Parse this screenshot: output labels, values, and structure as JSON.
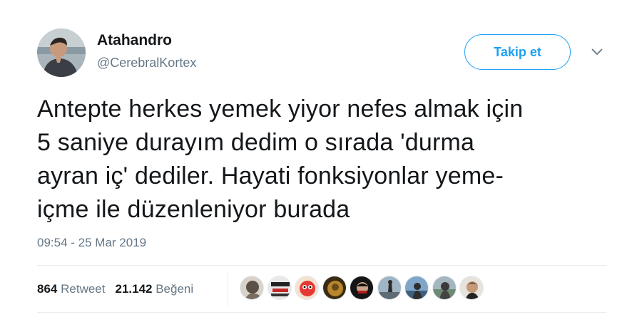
{
  "user": {
    "display_name": "Atahandro",
    "handle": "@CerebralKortex"
  },
  "follow_button": {
    "label": "Takip et"
  },
  "tweet": {
    "lines": [
      "Antepte herkes yemek yiyor nefes almak için",
      "5 saniye durayım dedim o sırada 'durma",
      "ayran iç' dediler. Hayati fonksiyonlar yeme-",
      "içme ile düzenleniyor burada"
    ],
    "timestamp": "09:54 - 25 Mar 2019"
  },
  "stats": {
    "retweet_count": "864",
    "retweet_label": "Retweet",
    "like_count": "21.142",
    "like_label": "Beğeni"
  },
  "colors": {
    "accent": "#1da1f2",
    "secondary_text": "#657786",
    "primary_text": "#14171a",
    "divider": "#e6ecf0"
  },
  "icons": {
    "caret": "chevron-down-icon"
  }
}
